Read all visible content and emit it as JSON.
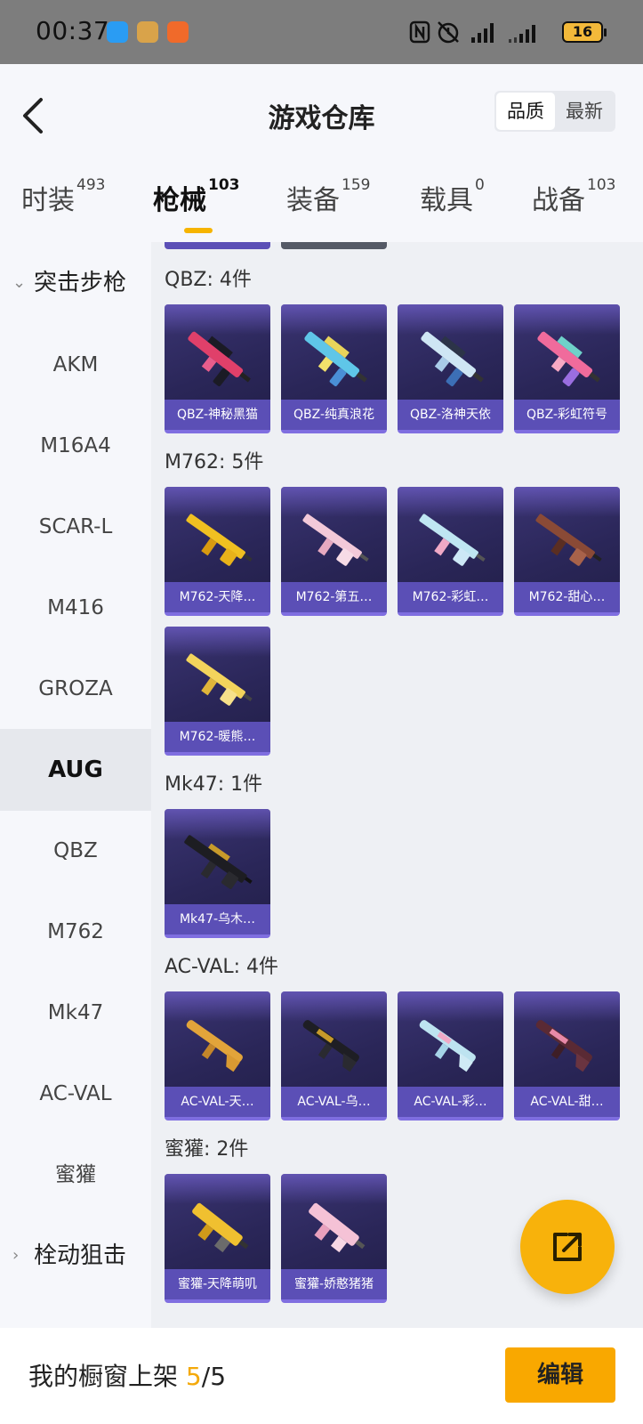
{
  "status_bar": {
    "time": "00:37",
    "battery": "16"
  },
  "header": {
    "title": "游戏仓库",
    "sort_options": [
      "品质",
      "最新"
    ]
  },
  "tabs": [
    {
      "label": "时装",
      "count": "493"
    },
    {
      "label": "枪械",
      "count": "103"
    },
    {
      "label": "装备",
      "count": "159"
    },
    {
      "label": "载具",
      "count": "0"
    },
    {
      "label": "战备",
      "count": "103"
    }
  ],
  "sidebar": {
    "group_open": "突击步枪",
    "items": [
      "AKM",
      "M16A4",
      "SCAR-L",
      "M416",
      "GROZA",
      "AUG",
      "QBZ",
      "M762",
      "Mk47",
      "AC-VAL",
      "蜜獾"
    ],
    "group_closed": "栓动狙击"
  },
  "sections": [
    {
      "title": "QBZ: 4件",
      "items": [
        "QBZ-神秘黑猫",
        "QBZ-纯真浪花",
        "QBZ-洛神天依",
        "QBZ-彩虹符号"
      ]
    },
    {
      "title": "M762: 5件",
      "items": [
        "M762-天降…",
        "M762-第五…",
        "M762-彩虹…",
        "M762-甜心…",
        "M762-暖熊…"
      ]
    },
    {
      "title": "Mk47: 1件",
      "items": [
        "Mk47-乌木…"
      ]
    },
    {
      "title": "AC-VAL: 4件",
      "items": [
        "AC-VAL-天…",
        "AC-VAL-乌…",
        "AC-VAL-彩…",
        "AC-VAL-甜…"
      ]
    },
    {
      "title": "蜜獾: 2件",
      "items": [
        "蜜獾-天降萌叽",
        "蜜獾-娇憨猪猪"
      ]
    }
  ],
  "footer": {
    "shelf_label": "我的橱窗上架",
    "shelf_current": "5",
    "shelf_sep": "/",
    "shelf_total": "5",
    "edit_label": "编辑"
  },
  "colors": {
    "accent": "#f9a800",
    "card_label": "#5b4fb6",
    "card_bg": "#2a2658"
  }
}
